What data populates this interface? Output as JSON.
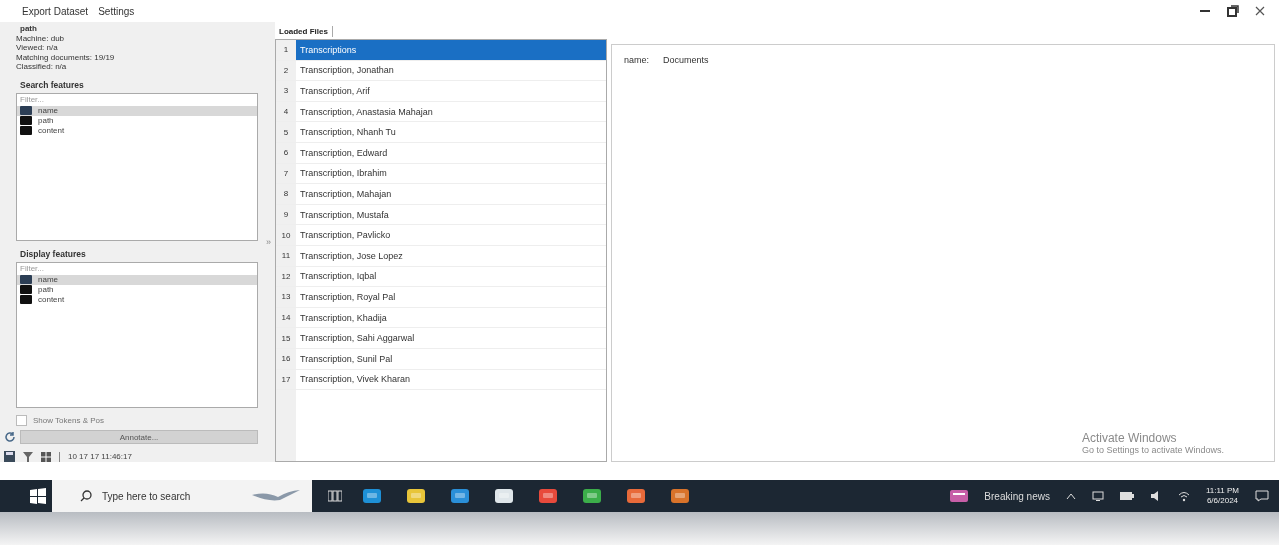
{
  "menu": [
    {
      "label": "Export Dataset"
    },
    {
      "label": "Settings"
    }
  ],
  "info": {
    "title": "path",
    "lines": [
      "Machine: dub",
      "Viewed: n/a",
      "Matching documents: 19/19",
      "Classified: n/a"
    ]
  },
  "search_features": {
    "title": "Search features",
    "placeholder": "Filter...",
    "items": [
      {
        "label": "name",
        "selected": true
      },
      {
        "label": "path",
        "selected": false
      },
      {
        "label": "content",
        "selected": false
      }
    ]
  },
  "display_features": {
    "title": "Display features",
    "placeholder": "Filter...",
    "items": [
      {
        "label": "name",
        "selected": true
      },
      {
        "label": "path",
        "selected": false
      },
      {
        "label": "content",
        "selected": false
      }
    ]
  },
  "option": {
    "label": "Show Tokens & Pos",
    "checked": false
  },
  "action_button": {
    "label": "Annotate...",
    "disabled": true
  },
  "status": "10 17 17 11:46:17",
  "splitter": {
    "label": "»"
  },
  "tab": {
    "label": "Loaded Files",
    "selected": true
  },
  "documents": [
    {
      "number": "1",
      "title": "Transcriptions",
      "selected": true
    },
    {
      "number": "2",
      "title": "Transcription, Jonathan",
      "selected": false
    },
    {
      "number": "3",
      "title": "Transcription, Arif",
      "selected": false
    },
    {
      "number": "4",
      "title": "Transcription, Anastasia Mahajan",
      "selected": false
    },
    {
      "number": "5",
      "title": "Transcription, Nhanh Tu",
      "selected": false
    },
    {
      "number": "6",
      "title": "Transcription, Edward",
      "selected": false
    },
    {
      "number": "7",
      "title": "Transcription, Ibrahim",
      "selected": false
    },
    {
      "number": "8",
      "title": "Transcription, Mahajan",
      "selected": false
    },
    {
      "number": "9",
      "title": "Transcription, Mustafa",
      "selected": false
    },
    {
      "number": "10",
      "title": "Transcription, Pavlicko",
      "selected": false
    },
    {
      "number": "11",
      "title": "Transcription, Jose Lopez",
      "selected": false
    },
    {
      "number": "12",
      "title": "Transcription, Iqbal",
      "selected": false
    },
    {
      "number": "13",
      "title": "Transcription, Royal Pal",
      "selected": false
    },
    {
      "number": "14",
      "title": "Transcription, Khadija",
      "selected": false
    },
    {
      "number": "15",
      "title": "Transcription, Sahi Aggarwal",
      "selected": false
    },
    {
      "number": "16",
      "title": "Transcription, Sunil Pal",
      "selected": false
    },
    {
      "number": "17",
      "title": "Transcription, Vivek Kharan",
      "selected": false
    }
  ],
  "detail": {
    "label": "name:",
    "value": "Documents"
  },
  "activation": {
    "title": "Activate Windows",
    "subtitle": "Go to Settings to activate Windows."
  },
  "taskbar": {
    "search_placeholder": "Type here to search",
    "news": "Breaking news",
    "time": "11:11 PM",
    "date": "6/6/2024"
  }
}
